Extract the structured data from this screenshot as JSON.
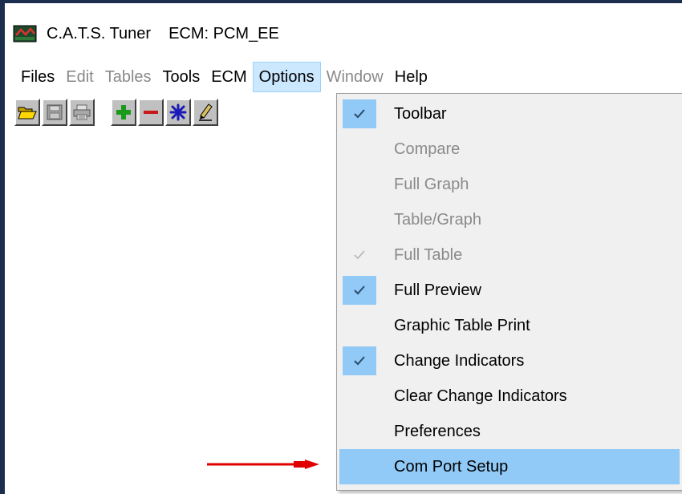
{
  "title": {
    "app_name": "C.A.T.S. Tuner",
    "ecm_label": "ECM: PCM_EE",
    "icon": "cats-tuner-app-icon"
  },
  "menubar": {
    "items": [
      {
        "label": "Files",
        "enabled": true
      },
      {
        "label": "Edit",
        "enabled": false
      },
      {
        "label": "Tables",
        "enabled": false
      },
      {
        "label": "Tools",
        "enabled": true
      },
      {
        "label": "ECM",
        "enabled": true
      },
      {
        "label": "Options",
        "enabled": true,
        "active": true
      },
      {
        "label": "Window",
        "enabled": false
      },
      {
        "label": "Help",
        "enabled": true
      }
    ]
  },
  "toolbar": {
    "buttons": [
      {
        "icon": "open-folder-icon"
      },
      {
        "icon": "save-disk-icon"
      },
      {
        "icon": "print-icon"
      },
      {
        "icon": "plus-icon"
      },
      {
        "icon": "minus-icon"
      },
      {
        "icon": "asterisk-icon"
      },
      {
        "icon": "pencil-icon"
      }
    ]
  },
  "options_menu": {
    "items": [
      {
        "label": "Toolbar",
        "enabled": true,
        "checked": true
      },
      {
        "label": "Compare",
        "enabled": false,
        "checked": false
      },
      {
        "label": "Full Graph",
        "enabled": false,
        "checked": false
      },
      {
        "label": "Table/Graph",
        "enabled": false,
        "checked": false
      },
      {
        "label": "Full Table",
        "enabled": false,
        "checked": true
      },
      {
        "label": "Full Preview",
        "enabled": true,
        "checked": true
      },
      {
        "label": "Graphic Table Print",
        "enabled": true,
        "checked": false
      },
      {
        "label": "Change Indicators",
        "enabled": true,
        "checked": true
      },
      {
        "label": "Clear Change Indicators",
        "enabled": true,
        "checked": false
      },
      {
        "label": "Preferences",
        "enabled": true,
        "checked": false
      },
      {
        "label": "Com Port Setup",
        "enabled": true,
        "checked": false,
        "highlighted": true
      }
    ]
  },
  "colors": {
    "window_border": "#1b2e4e",
    "menu_highlight": "#91c9f7",
    "menubar_active": "#cce8ff",
    "disabled_text": "#8a8a8a",
    "annotation_arrow": "#e00000"
  }
}
